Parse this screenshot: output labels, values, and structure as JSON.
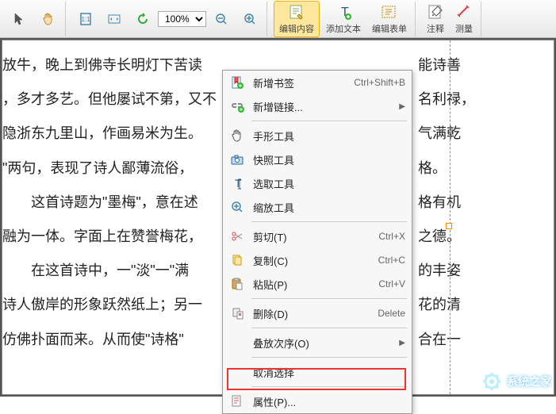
{
  "toolbar": {
    "zoom_value": "100%",
    "edit_content": "编辑内容",
    "add_text": "添加文本",
    "edit_form": "编辑表单",
    "annotate": "注释",
    "measure": "测量"
  },
  "document": {
    "lines": [
      "放牛，晚上到佛寺长明灯下苦读",
      "，多才多艺。但他屡试不第，又不",
      "隐浙东九里山，作画易米为生。",
      "\"两句，表现了诗人鄙薄流俗，",
      "　　这首诗题为\"墨梅\"，意在述",
      "融为一体。字面上在赞誉梅花，",
      "　　在这首诗中，一\"淡\"一\"满",
      "诗人傲岸的形象跃然纸上；另一",
      "仿佛扑面而来。从而使\"诗格\""
    ],
    "frag": [
      "能诗善",
      "名利禄，",
      "气满乾",
      "格。",
      "格有机",
      "之德。",
      "的丰姿",
      "花的清",
      "合在一"
    ]
  },
  "context_menu": {
    "add_bookmark": "新增书签",
    "add_bookmark_sc": "Ctrl+Shift+B",
    "add_link": "新增链接...",
    "hand_tool": "手形工具",
    "snapshot_tool": "快照工具",
    "select_tool": "选取工具",
    "zoom_tool": "缩放工具",
    "cut": "剪切(T)",
    "cut_sc": "Ctrl+X",
    "copy": "复制(C)",
    "copy_sc": "Ctrl+C",
    "paste": "粘贴(P)",
    "paste_sc": "Ctrl+V",
    "delete": "删除(D)",
    "delete_sc": "Delete",
    "stacking": "叠放次序(O)",
    "deselect": "取消选择",
    "properties": "属性(P)..."
  },
  "watermark": "系统之家"
}
